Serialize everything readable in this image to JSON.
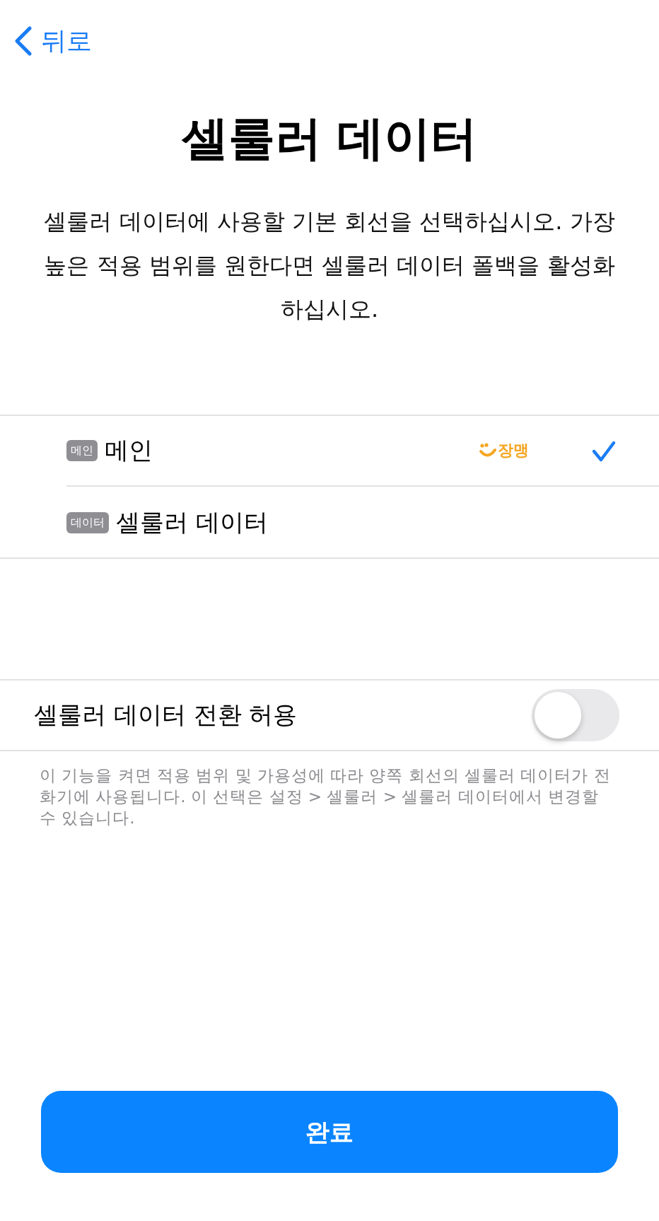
{
  "nav": {
    "back": "뒤로"
  },
  "title": "셀룰러 데이터",
  "description": "셀룰러 데이터에 사용할 기본 회선을 선택하십시오. 가장 높은 적용 범위를 원한다면 셀룰러 데이터 폴백을 활성화하십시오.",
  "lines": [
    {
      "badge": "메인",
      "label": "메인",
      "carrier": "장맹",
      "selected": true
    },
    {
      "badge": "데이터",
      "label": "셀룰러 데이터",
      "selected": false
    }
  ],
  "switching": {
    "label": "셀룰러 데이터 전환 허용",
    "on": false
  },
  "footnote": "이 기능을 켜면 적용 범위 및 가용성에 따라 양쪽 회선의 셀룰러 데이터가 전화기에 사용됩니다. 이 선택은 설정 > 셀룰러 > 셀룰러 데이터에서 변경할 수 있습니다.",
  "done_button": "완료"
}
